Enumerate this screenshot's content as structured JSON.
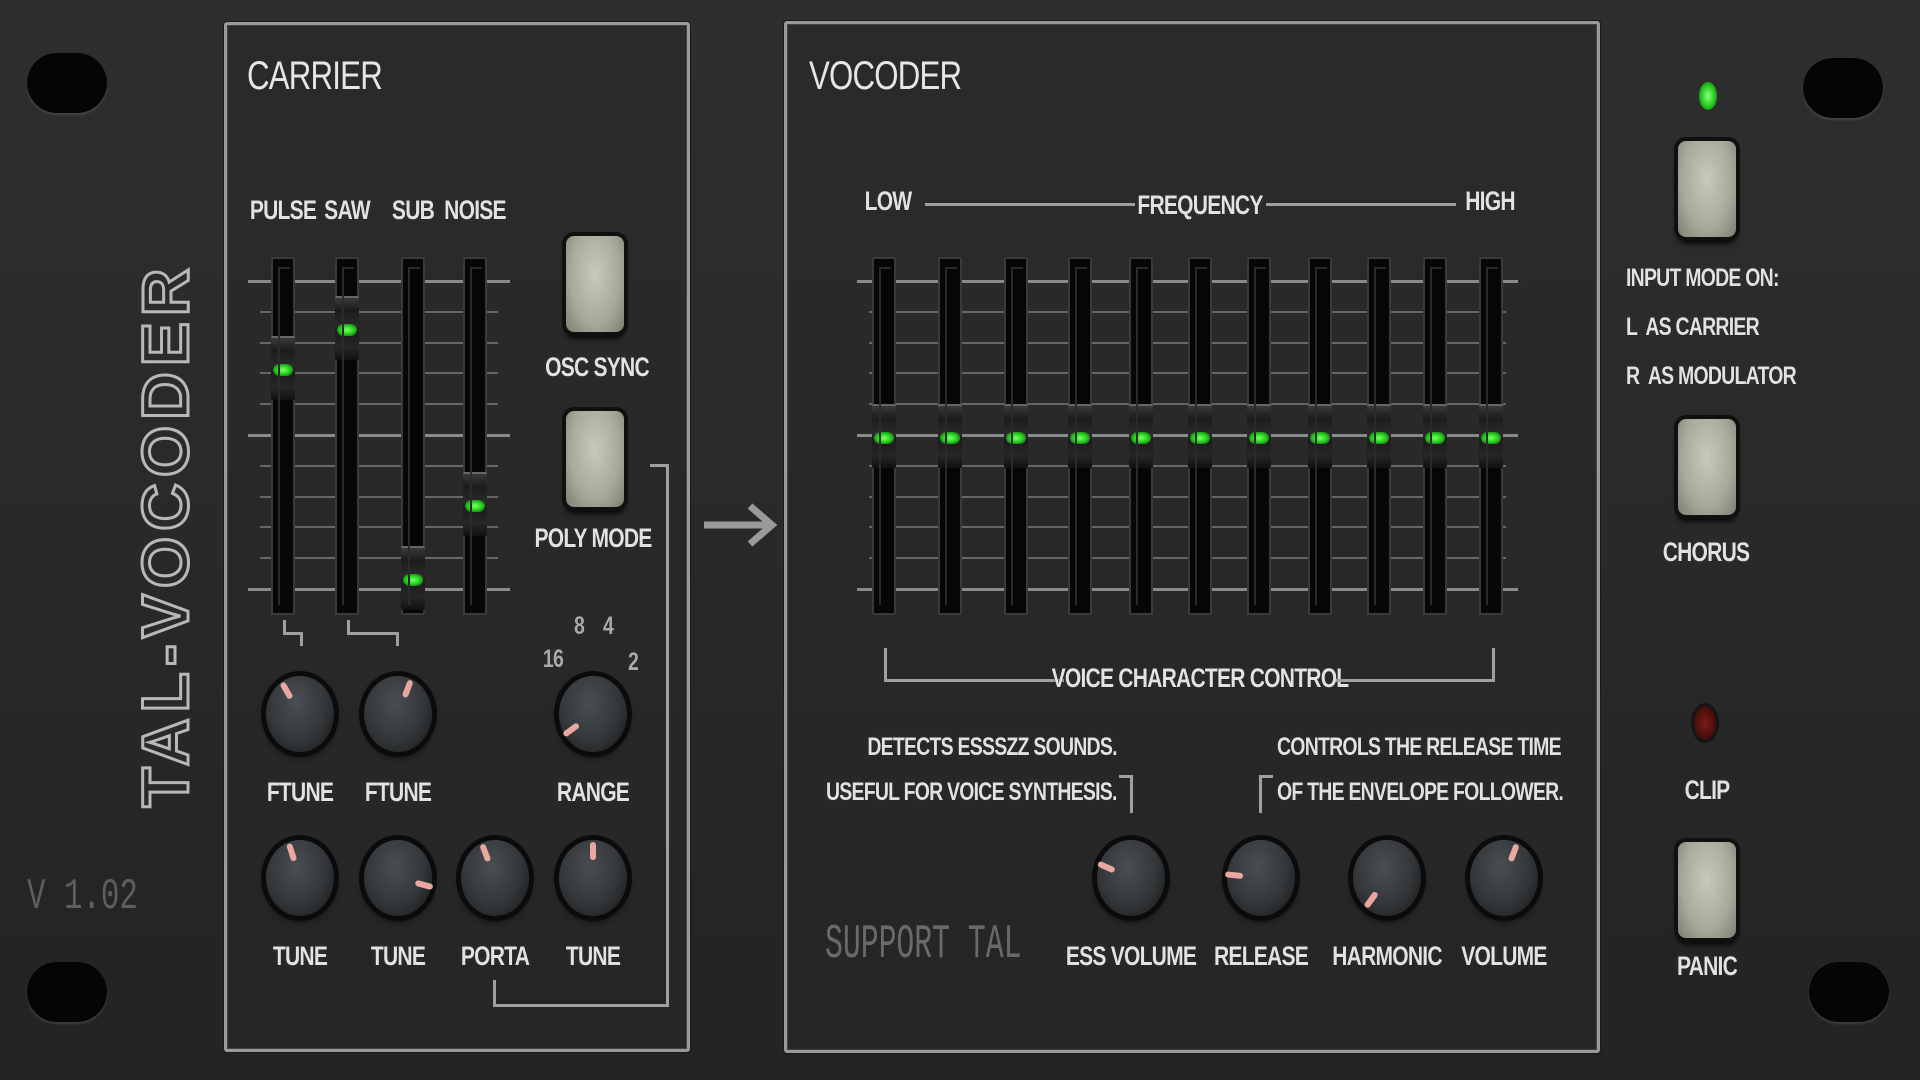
{
  "brand": {
    "name": "TAL-VOCODER",
    "version": "V 1.02",
    "support": "SUPPORT TAL"
  },
  "carrier": {
    "title": "CARRIER",
    "sliders": [
      {
        "label": "PULSE",
        "value": 0.72
      },
      {
        "label": "SAW",
        "value": 0.85
      },
      {
        "label": "SUB",
        "value": 0.04
      },
      {
        "label": "NOISE",
        "value": 0.28
      }
    ],
    "osc_sync": {
      "label": "OSC SYNC"
    },
    "poly_mode": {
      "label": "POLY MODE"
    },
    "knobs": [
      {
        "label": "FTUNE",
        "value": 0.4
      },
      {
        "label": "FTUNE",
        "value": 0.57
      },
      {
        "label": "RANGE",
        "value": 0.08
      },
      {
        "label": "TUNE",
        "value": 0.44
      },
      {
        "label": "TUNE",
        "value": 0.85
      },
      {
        "label": "PORTA",
        "value": 0.43
      },
      {
        "label": "TUNE",
        "value": 0.5
      }
    ],
    "range_marks": [
      "16",
      "8",
      "4",
      "2"
    ]
  },
  "vocoder": {
    "title": "VOCODER",
    "low": "LOW",
    "frequency": "FREQUENCY",
    "high": "HIGH",
    "bands": [
      0.5,
      0.5,
      0.5,
      0.5,
      0.5,
      0.5,
      0.5,
      0.5,
      0.5,
      0.5,
      0.5
    ],
    "voice_character": "VOICE CHARACTER CONTROL",
    "ess_note": [
      "DETECTS ESSSZZ SOUNDS.",
      "USEFUL FOR VOICE SYNTHESIS."
    ],
    "release_note": [
      "CONTROLS THE RELEASE TIME",
      "OF THE ENVELOPE FOLLOWER."
    ],
    "knobs": [
      {
        "label": "ESS VOLUME",
        "value": 0.28
      },
      {
        "label": "RELEASE",
        "value": 0.22
      },
      {
        "label": "HARMONIC",
        "value": 0.02
      },
      {
        "label": "VOLUME",
        "value": 0.57
      }
    ]
  },
  "right": {
    "input_mode_led": "on",
    "input_mode": [
      "INPUT MODE ON:",
      "L  AS CARRIER",
      "R  AS MODULATOR"
    ],
    "chorus": "CHORUS",
    "clip": "CLIP",
    "clip_led": "off",
    "panic": "PANIC"
  },
  "colors": {
    "led_on": "#2fe02a",
    "led_clip_off": "#5a1410",
    "button": "#b8b8a8",
    "pointer": "#e8a8a0"
  }
}
